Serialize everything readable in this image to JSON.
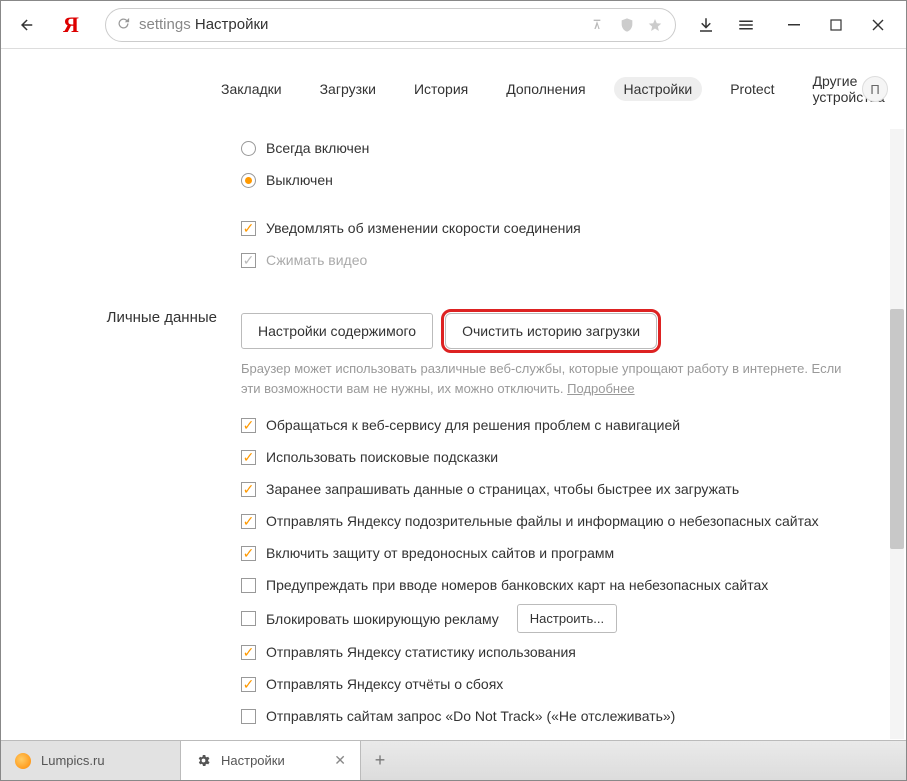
{
  "toolbar": {
    "url_prefix": "settings",
    "url_text": "Настройки"
  },
  "nav": {
    "items": [
      "Закладки",
      "Загрузки",
      "История",
      "Дополнения",
      "Настройки",
      "Protect",
      "Другие устройства"
    ],
    "user_initial": "П"
  },
  "radios": {
    "always_on": "Всегда включен",
    "off": "Выключен"
  },
  "top_checks": {
    "notify_speed": "Уведомлять об изменении скорости соединения",
    "compress_video": "Сжимать видео"
  },
  "section": {
    "label": "Личные данные",
    "btn_content": "Настройки содержимого",
    "btn_clear": "Очистить историю загрузки",
    "desc_text": "Браузер может использовать различные веб-службы, которые упрощают работу в интернете. Если эти возможности вам не нужны, их можно отключить. ",
    "desc_link": "Подробнее"
  },
  "checks": [
    {
      "label": "Обращаться к веб-сервису для решения проблем с навигацией",
      "checked": true
    },
    {
      "label": "Использовать поисковые подсказки",
      "checked": true
    },
    {
      "label": "Заранее запрашивать данные о страницах, чтобы быстрее их загружать",
      "checked": true
    },
    {
      "label": "Отправлять Яндексу подозрительные файлы и информацию о небезопасных сайтах",
      "checked": true
    },
    {
      "label": "Включить защиту от вредоносных сайтов и программ",
      "checked": true
    },
    {
      "label": "Предупреждать при вводе номеров банковских карт на небезопасных сайтах",
      "checked": false
    },
    {
      "label": "Блокировать шокирующую рекламу",
      "checked": false,
      "config_btn": "Настроить..."
    },
    {
      "label": "Отправлять Яндексу статистику использования",
      "checked": true
    },
    {
      "label": "Отправлять Яндексу отчёты о сбоях",
      "checked": true
    },
    {
      "label": "Отправлять сайтам запрос «Do Not Track» («Не отслеживать»)",
      "checked": false
    }
  ],
  "tabs": {
    "lumpics": "Lumpics.ru",
    "settings": "Настройки"
  }
}
